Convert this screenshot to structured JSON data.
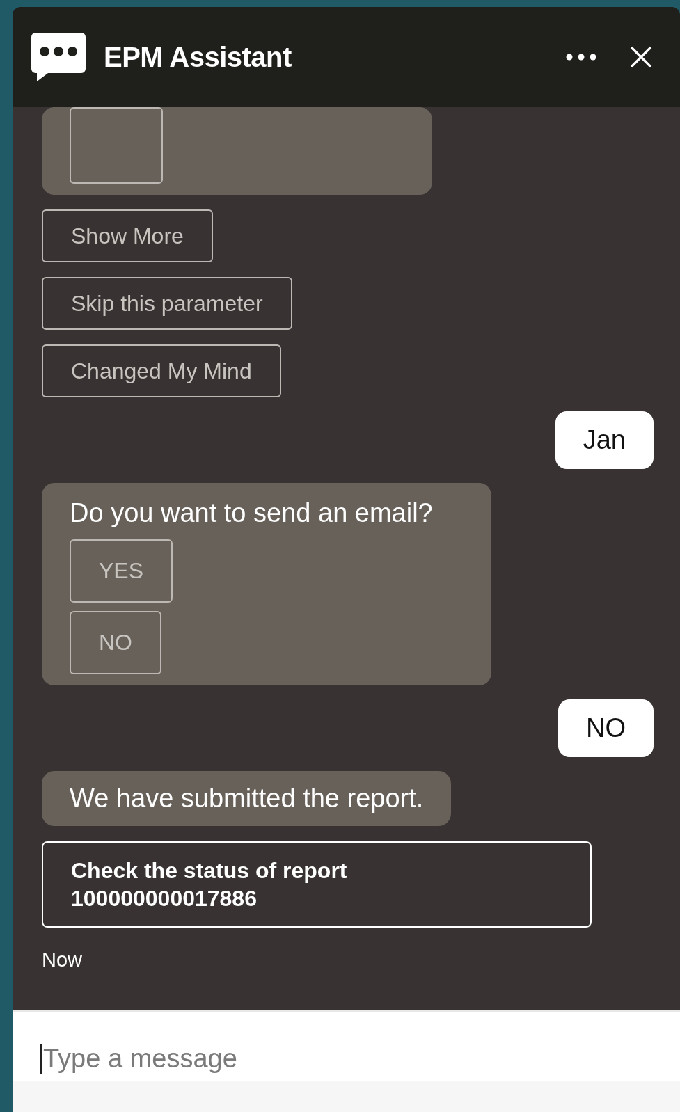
{
  "header": {
    "title": "EPM Assistant"
  },
  "messages": [
    {
      "kind": "clipped_card"
    },
    {
      "kind": "option",
      "label": "Show More"
    },
    {
      "kind": "option",
      "label": "Skip this parameter"
    },
    {
      "kind": "option",
      "label": "Changed My Mind"
    },
    {
      "kind": "user",
      "text": "Jan"
    },
    {
      "kind": "bot",
      "text": "Do you want to send an email?",
      "buttons": [
        "YES",
        "NO"
      ]
    },
    {
      "kind": "user",
      "text": "NO"
    },
    {
      "kind": "bot",
      "text": "We have submitted the report."
    },
    {
      "kind": "card",
      "text": "Check the status of report 100000000017886"
    },
    {
      "kind": "time",
      "text": "Now"
    }
  ],
  "composer": {
    "placeholder": "Type a message"
  }
}
